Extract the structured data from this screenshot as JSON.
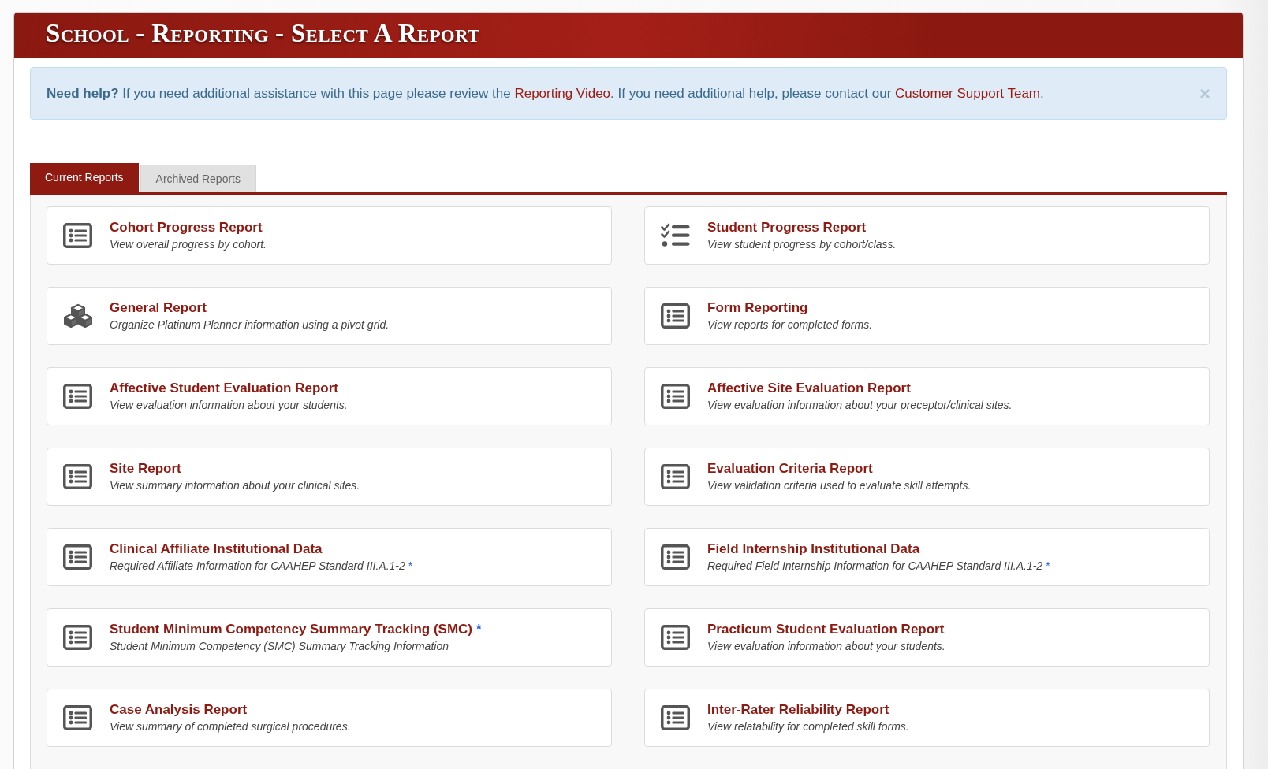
{
  "header": {
    "title": "School - Reporting - Select A Report"
  },
  "help_alert": {
    "segments": [
      {
        "kind": "text",
        "text": "**Need help?** If you need additional assistance with this page please review the "
      },
      {
        "kind": "link",
        "text": "Reporting Video"
      },
      {
        "kind": "text",
        "text": ". If you need additional help, please contact our "
      },
      {
        "kind": "link",
        "text": "Customer Support Team"
      },
      {
        "kind": "text",
        "text": "."
      }
    ],
    "close": "×"
  },
  "tabs": [
    {
      "label": "Current Reports",
      "selected": true
    },
    {
      "label": "Archived Reports",
      "selected": false
    }
  ],
  "reports": [
    {
      "kind": "list",
      "title": "Cohort Progress Report",
      "description": "View overall progress by cohort."
    },
    {
      "kind": "tasks",
      "title": "Student Progress Report",
      "description": "View student progress by cohort/class."
    },
    {
      "kind": "cubes",
      "title": "General Report",
      "description": "Organize Platinum Planner information using a pivot grid."
    },
    {
      "kind": "list",
      "title": "Form Reporting",
      "description": "View reports for completed forms."
    },
    {
      "kind": "list",
      "title": "Affective Student Evaluation Report",
      "description": "View evaluation information about your students."
    },
    {
      "kind": "list",
      "title": "Affective Site Evaluation Report",
      "description": "View evaluation information about your preceptor/clinical sites."
    },
    {
      "kind": "list",
      "title": "Site Report",
      "description": "View summary information about your clinical sites."
    },
    {
      "kind": "list",
      "title": "Evaluation Criteria Report",
      "description": "View validation criteria used to evaluate skill attempts."
    },
    {
      "kind": "list",
      "title": "Clinical Affiliate Institutional Data",
      "description": "Required Affiliate Information for CAAHEP Standard III.A.1-2",
      "description_mark": "*"
    },
    {
      "kind": "list",
      "title": "Field Internship Institutional Data",
      "description": "Required Field Internship Information for CAAHEP Standard III.A.1-2",
      "description_mark": "*"
    },
    {
      "kind": "list",
      "title": "Student Minimum Competency Summary Tracking (SMC)",
      "title_mark": "*",
      "description": "Student Minimum Competency (SMC) Summary Tracking Information"
    },
    {
      "kind": "list",
      "title": "Practicum Student Evaluation Report",
      "description": "View evaluation information about your students."
    },
    {
      "kind": "list",
      "title": "Case Analysis Report",
      "description": "View summary of completed surgical procedures."
    },
    {
      "kind": "list",
      "title": "Inter-Rater Reliability Report",
      "description": "View relatability for completed skill forms."
    }
  ]
}
